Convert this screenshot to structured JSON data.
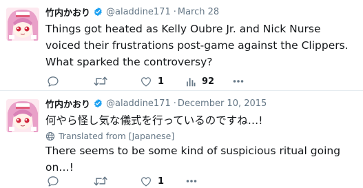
{
  "tweets": [
    {
      "display_name": "竹内かおり",
      "handle": "@aladdine171",
      "separator": "·",
      "date": "March 28",
      "text": "Things got heated as Kelly Oubre Jr. and Nick Nurse voiced their frustrations post-game against the Clippers. What sparked the controversy?",
      "likes": "1",
      "views": "92"
    },
    {
      "display_name": "竹内かおり",
      "handle": "@aladdine171",
      "separator": "·",
      "date": "December 10, 2015",
      "text": "何やら怪し気な儀式を行っているのですね…!",
      "translated_label": "Translated from [Japanese]",
      "translation": "There seems to be some kind of suspicious ritual going on…!",
      "likes": "1"
    }
  ],
  "colors": {
    "text": "#14171a",
    "secondary": "#657786",
    "verified": "#1da1f2",
    "divider": "#e6ecf0"
  },
  "icons": [
    "verified-badge-icon",
    "reply-icon",
    "retweet-icon",
    "like-icon",
    "analytics-icon",
    "more-icon",
    "globe-icon"
  ]
}
